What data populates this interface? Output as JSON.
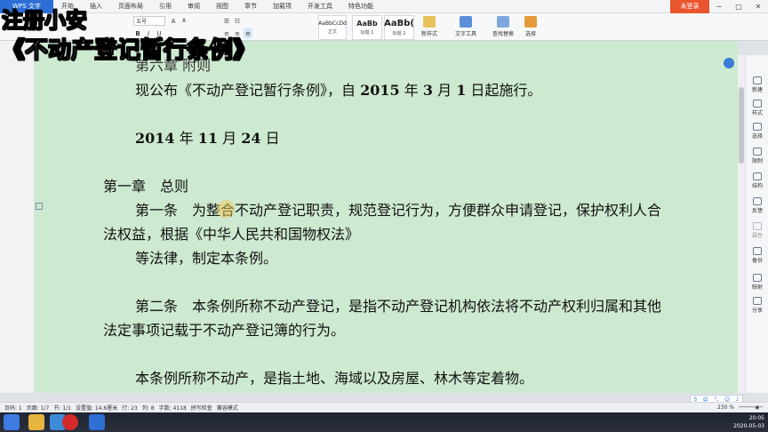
{
  "menubar": {
    "app": "WPS 文字",
    "items": [
      "开始",
      "插入",
      "页面布局",
      "引用",
      "审阅",
      "视图",
      "章节",
      "加载项",
      "开发工具",
      "特色功能"
    ],
    "login": "未登录"
  },
  "ribbon": {
    "font_size": "五号",
    "styles": [
      {
        "sample": "AaBbCcDd",
        "name": "正文"
      },
      {
        "sample": "AaBb",
        "name": "标题 1"
      },
      {
        "sample": "AaBb(",
        "name": "标题 2"
      }
    ],
    "tools": [
      "新样式",
      "文字工具",
      "查找替换",
      "选择"
    ]
  },
  "caption": {
    "line1": "注册小安",
    "line2": "《不动产登记暂行条例》"
  },
  "document": {
    "header_partial": "第六章 附则",
    "announce": "现公布《不动产登记暂行条例》，自",
    "announce_year": "2015",
    "announce_mid": "年",
    "announce_month": "3",
    "announce_mid2": "月",
    "announce_day": "1",
    "announce_end": "日起施行。",
    "date_year": "2014",
    "date_y": "年",
    "date_month": "11",
    "date_m": "月",
    "date_day": "24",
    "date_d": "日",
    "chapter1": "第一章　总则",
    "art1_line1": "第一条　为整合不动产登记职责，规范登记行为，方便群众申请登记，保护权利人合",
    "art1_line2": "法权益，根据《中华人民共和国物权法》",
    "art1_line3": "等法律，制定本条例。",
    "art2_line1": "第二条　本条例所称不动产登记，是指不动产登记机构依法将不动产权利归属和其他",
    "art2_line2": "法定事项记载于不动产登记簿的行为。",
    "art2_line3": "本条例所称不动产，是指土地、海域以及房屋、林木等定着物。"
  },
  "task_pane": [
    "新建",
    "样式",
    "选择",
    "限制",
    "结构",
    "反馈",
    "属性",
    "备份",
    "映射",
    "分享"
  ],
  "status": {
    "page": "页码: 1",
    "pages": "页面: 1/7",
    "section": "节: 1/1",
    "position": "设置值: 14.6厘米",
    "row": "行: 23",
    "col": "列: 8",
    "words": "字数: 4118",
    "spell": "拼写检查",
    "mode": "兼容模式",
    "zoom": "230 %"
  },
  "tray": {
    "time": "20:05",
    "date": "2020-05-03"
  },
  "colors": {
    "page_bg": "#cde9d0",
    "accent": "#2b6fd6",
    "login_btn": "#e9552f"
  }
}
